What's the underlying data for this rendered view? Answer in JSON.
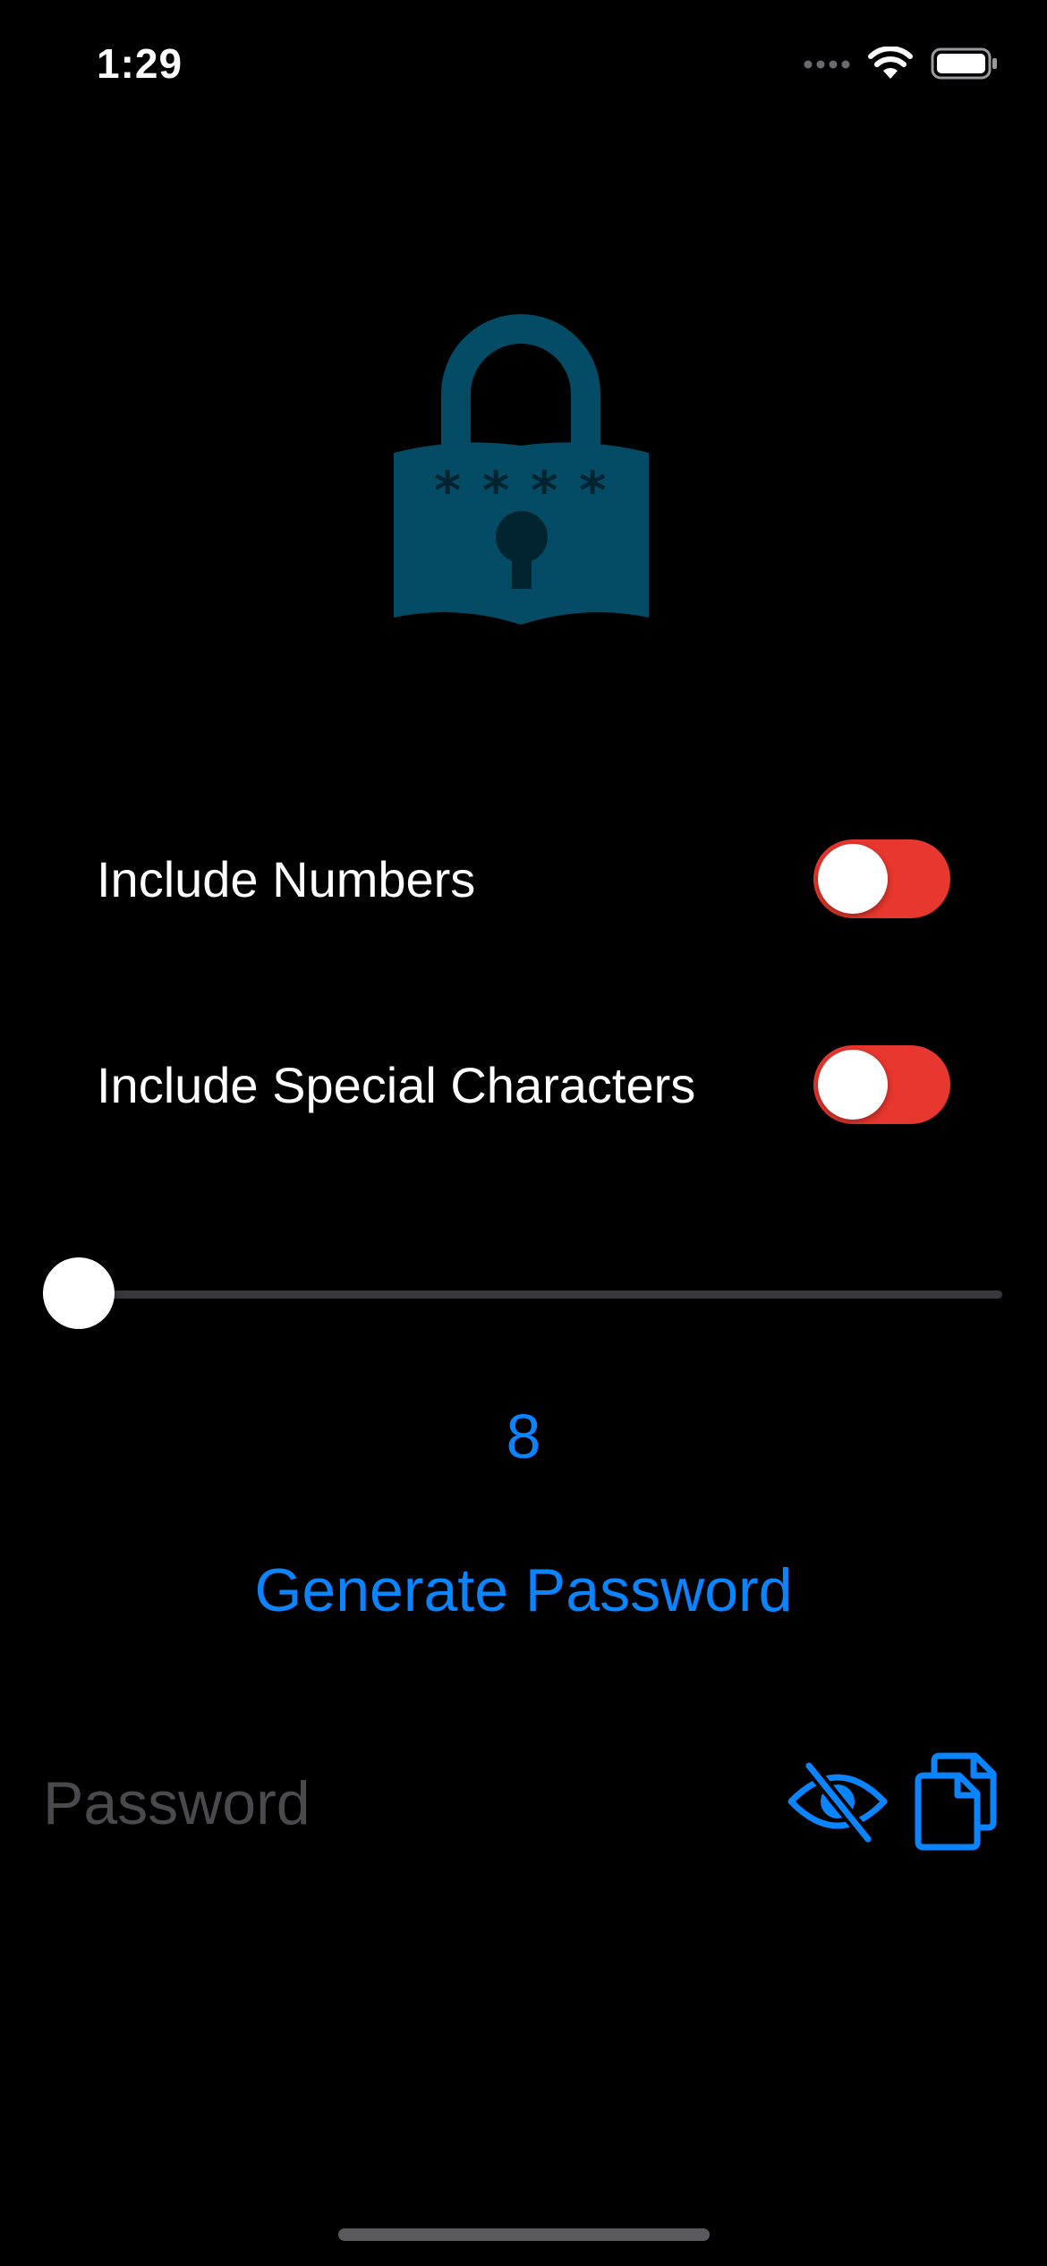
{
  "status_bar": {
    "time": "1:29"
  },
  "icons": {
    "lock": "lock-asterisk-icon",
    "eye": "eye-slash-icon",
    "copy": "copy-icon"
  },
  "options": {
    "numbers_label": "Include Numbers",
    "numbers_on": true,
    "special_label": "Include Special Characters",
    "special_on": true
  },
  "slider": {
    "value": 8,
    "position_fraction": 0.0
  },
  "length_display": "8",
  "generate_button_label": "Generate Password",
  "password_field": {
    "value": "",
    "placeholder": "Password"
  },
  "colors": {
    "accent": "#0a84ff",
    "toggle_on": "#e8372e",
    "lock": "#044b65",
    "background": "#000000"
  }
}
